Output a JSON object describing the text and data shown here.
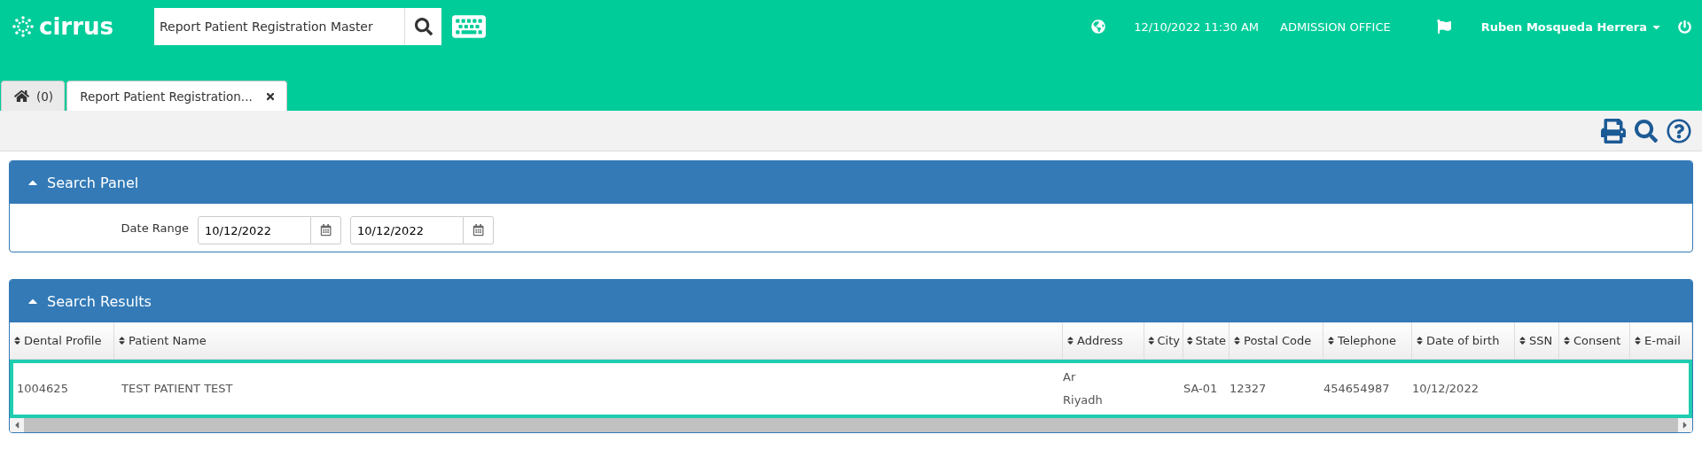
{
  "header": {
    "logo": "cirrus",
    "search": {
      "value": "Report Patient Registration Master"
    },
    "datetime": "12/10/2022 11:30 AM",
    "office": "ADMISSION OFFICE",
    "user": "Ruben Mosqueda Herrera"
  },
  "tabs": [
    {
      "label": "(0)",
      "kind": "home",
      "selected": false
    },
    {
      "label": "Report Patient Registration...",
      "kind": "page",
      "selected": true
    }
  ],
  "search_panel": {
    "title": "Search Panel",
    "expanded": true,
    "date_range_label": "Date Range",
    "date_from": "10/12/2022",
    "date_to": "10/12/2022"
  },
  "results": {
    "title": "Search Results",
    "expanded": true,
    "columns": [
      "Dental Profile",
      "Patient Name",
      "Address",
      "City",
      "State",
      "Postal Code",
      "Telephone",
      "Date of birth",
      "SSN",
      "Consent",
      "E-mail"
    ],
    "rows": [
      {
        "selected": true,
        "cells": [
          "1004625",
          "TEST PATIENT TEST",
          "Ar\nRiyadh",
          "",
          "SA-01",
          "12327",
          "454654987",
          "10/12/2022",
          "",
          "",
          ""
        ]
      }
    ]
  }
}
